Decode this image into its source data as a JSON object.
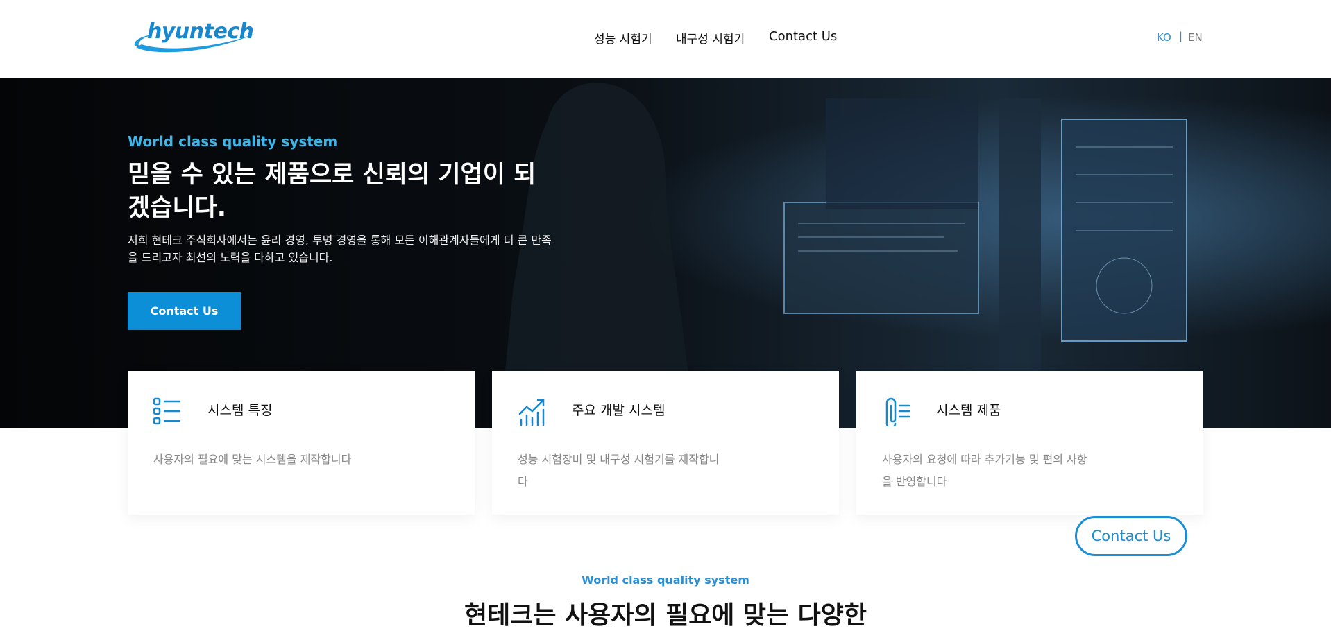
{
  "header": {
    "logo_text": "hyuntech",
    "nav": [
      "성능 시험기",
      "내구성 시험기",
      "Contact Us"
    ],
    "lang": {
      "ko": "KO",
      "sep": "|",
      "en": "EN"
    }
  },
  "hero": {
    "eyebrow": "World class quality system",
    "title": "믿을 수 있는 제품으로 신뢰의 기업이 되겠습니다.",
    "description": "저희 현테크 주식회사에서는 윤리 경영, 투명 경영을 통해 모든 이해관계자들에게 더 큰 만족을 드리고자 최선의 노력을 다하고 있습니다.",
    "button": "Contact Us"
  },
  "cards": [
    {
      "icon": "list-icon",
      "title": "시스템 특징",
      "description": "사용자의 필요에 맞는 시스템을 제작합니다"
    },
    {
      "icon": "chart-trend-icon",
      "title": "주요 개발 시스템",
      "description": "성능 시험장비 및 내구성 시험기를 제작합니다"
    },
    {
      "icon": "paperclip-icon",
      "title": "시스템 제품",
      "description": "사용자의 요청에 따라 추가기능 및 편의 사항을 반영합니다"
    }
  ],
  "floating_contact": "Contact Us",
  "section": {
    "eyebrow": "World class quality system",
    "title": "현테크는 사용자의 필요에 맞는 다양한"
  },
  "colors": {
    "accent": "#0c8fd6",
    "eyebrow": "#3fb6ea",
    "hero_bg": "#050608"
  }
}
